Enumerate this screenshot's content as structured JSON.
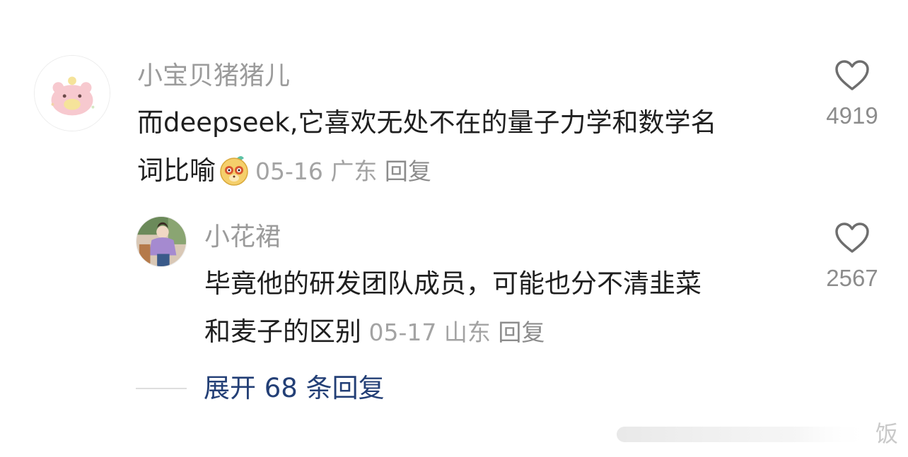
{
  "comments": [
    {
      "username": "小宝贝猪猪儿",
      "text_line1": "而deepseek,它喜欢无处不在的量子力学和数学名",
      "text_line2": "词比喻",
      "emoji": "monkey-face-emoji",
      "date": "05-16",
      "location": "广东",
      "reply_label": "回复",
      "likes": "4919",
      "like_icon": "heart-outline-icon"
    },
    {
      "username": "小花裙",
      "text_line1": "毕竟他的研发团队成员，可能也分不清韭菜",
      "text_line2": "和麦子的区别",
      "date": "05-17",
      "location": "山东",
      "reply_label": "回复",
      "likes": "2567",
      "like_icon": "heart-outline-icon"
    }
  ],
  "expand_replies": "展开 68 条回复",
  "watermark": "饭",
  "colors": {
    "username": "#9b9b9b",
    "body": "#1f1f1f",
    "meta": "#a3a3a3",
    "expand_link": "#233f76",
    "heart": "#6e6e6e"
  }
}
